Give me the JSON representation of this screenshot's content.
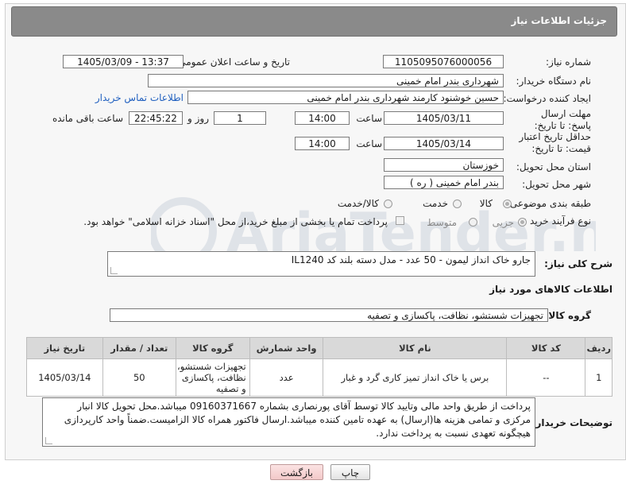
{
  "header": {
    "title": "جزئیات اطلاعات نیاز"
  },
  "fields": {
    "need_number": {
      "label": "شماره نیاز:",
      "value": "1105095076000056"
    },
    "announce_datetime": {
      "label": "تاریخ و ساعت اعلان عمومی:",
      "value": "1405/03/09 - 13:37"
    },
    "buyer_org": {
      "label": "نام دستگاه خریدار:",
      "value": "شهرداری بندر امام خمینی"
    },
    "requester": {
      "label": "ایجاد کننده درخواست:",
      "value": "حسین خوشنود کارمند شهرداری بندر امام خمینی",
      "contact_link": "اطلاعات تماس خریدار"
    },
    "response_deadline": {
      "label": "مهلت ارسال پاسخ: تا تاریخ:",
      "date": "1405/03/11",
      "time_label": "ساعت",
      "time": "14:00",
      "days": "1",
      "days_label": "روز و",
      "remaining": "22:45:22",
      "remaining_label": "ساعت باقی مانده"
    },
    "price_validity": {
      "label": "حداقل تاریخ اعتبار قیمت: تا تاریخ:",
      "date": "1405/03/14",
      "time_label": "ساعت",
      "time": "14:00"
    },
    "province": {
      "label": "استان محل تحویل:",
      "value": "خوزستان"
    },
    "city": {
      "label": "شهر محل تحویل:",
      "value": "بندر امام خمینی ( ره )"
    },
    "category": {
      "label": "طبقه بندی موضوعی:",
      "options": [
        "کالا",
        "خدمت",
        "کالا/خدمت"
      ]
    },
    "purchase_type": {
      "label": "نوع فرآیند خرید :",
      "options": [
        "جزیی",
        "متوسط"
      ],
      "payment_note": "پرداخت تمام یا بخشی از مبلغ خرید،از محل \"اسناد خزانه اسلامی\" خواهد بود."
    }
  },
  "summary": {
    "label": "شرح کلی نیاز:",
    "value": "جارو خاک انداز لیمون - 50 عدد -  مدل دسته بلند کد IL1240"
  },
  "goods_section": {
    "title": "اطلاعات کالاهای مورد نیاز",
    "group_label": "گروه کالا:",
    "group_value": "تجهیزات شستشو، نظافت، پاکسازی و تصفیه"
  },
  "table": {
    "headers": [
      "ردیف",
      "کد کالا",
      "نام کالا",
      "واحد شمارش",
      "گروه کالا",
      "تعداد / مقدار",
      "تاریخ نیاز"
    ],
    "rows": [
      {
        "row": "1",
        "code": "--",
        "name": "برس یا خاک انداز تمیز کاری گرد و غبار",
        "unit": "عدد",
        "group": "تجهیزات شستشو، نظافت، پاکسازی و تصفیه",
        "qty": "50",
        "date": "1405/03/14"
      }
    ]
  },
  "buyer_notes": {
    "label": "توضیحات خریدار:",
    "value": "پرداخت از طریق واحد مالی وتایید کالا توسط آقای پورنصاری بشماره 09160371667 میباشد.محل تحویل کالا انبار مرکزی و تمامی هزینه ها(ارسال) به عهده تامین کننده میباشد.ارسال فاکتور همراه کالا الزامیست.ضمناً واحد کارپردازی هیچگونه تعهدی نسبت به پرداخت ندارد."
  },
  "buttons": {
    "print": "چاپ",
    "back": "بازگشت"
  },
  "watermark": {
    "text": "AriaTender.neT"
  }
}
